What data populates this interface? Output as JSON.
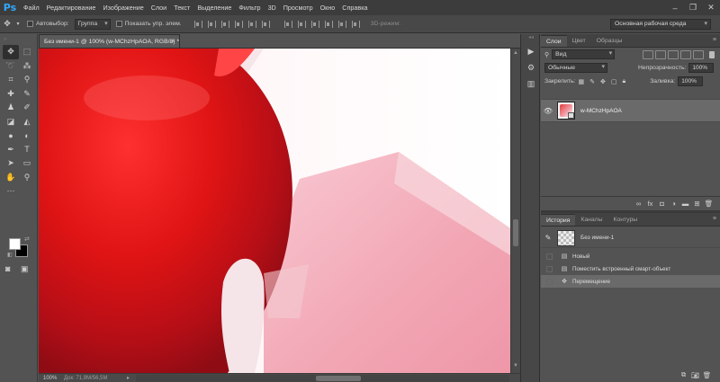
{
  "app": {
    "logo": "Ps",
    "menu": [
      "Файл",
      "Редактирование",
      "Изображение",
      "Слои",
      "Текст",
      "Выделение",
      "Фильтр",
      "3D",
      "Просмотр",
      "Окно",
      "Справка"
    ]
  },
  "options": {
    "autoselect_label": "Автовыбор:",
    "autoselect_value": "Группа",
    "show_controls_label": "Показать упр. элем.",
    "mode3d_label": "3D-режим:",
    "workspace": "Основная рабочая среда"
  },
  "document": {
    "tab_title": "Без имени-1 @ 100% (w-MChzHpAOA, RGB/8) *",
    "zoom": "100%",
    "doc_info": "Док: 71,9M/56,5M"
  },
  "layers": {
    "tabs": [
      "Слои",
      "Цвет",
      "Образцы"
    ],
    "filter_kind": "Вид",
    "blend_mode": "Обычные",
    "opacity_label": "Непрозрачность:",
    "opacity_value": "100%",
    "lock_label": "Закрепить:",
    "fill_label": "Заливка:",
    "fill_value": "100%",
    "items": [
      {
        "name": "w-MChzHpAOA"
      }
    ]
  },
  "history": {
    "tabs": [
      "История",
      "Каналы",
      "Контуры"
    ],
    "snapshot": "Без имени-1",
    "items": [
      {
        "label": "Новый"
      },
      {
        "label": "Поместить встроенный смарт-объект"
      },
      {
        "label": "Перемещение"
      }
    ]
  },
  "colors": {
    "foreground": "#ffffff",
    "background": "#000000",
    "accent": "#31a8ff"
  }
}
